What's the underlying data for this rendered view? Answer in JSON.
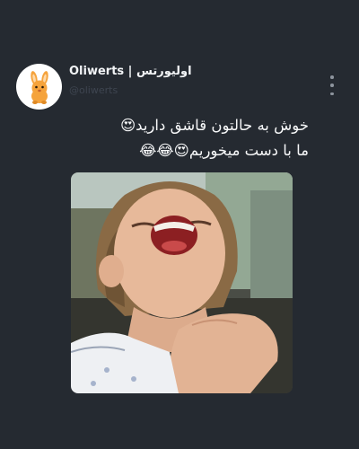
{
  "post": {
    "author_name": "Oliwerts | اولیورتس",
    "author_handle": "@oliwerts",
    "avatar_icon": "bunny-icon",
    "more_icon": "more-vertical-icon",
    "text_line_1": "خوش به حالتون قاشق دارید😍",
    "text_line_2": "ما با دست میخوریم😍😂😂"
  },
  "media": {
    "subject": "girl-laughing-photo"
  },
  "colors": {
    "background": "#252a31",
    "text": "#f6f7f8",
    "muted": "#8d949d",
    "avatar_accent": "#f5a33c"
  }
}
